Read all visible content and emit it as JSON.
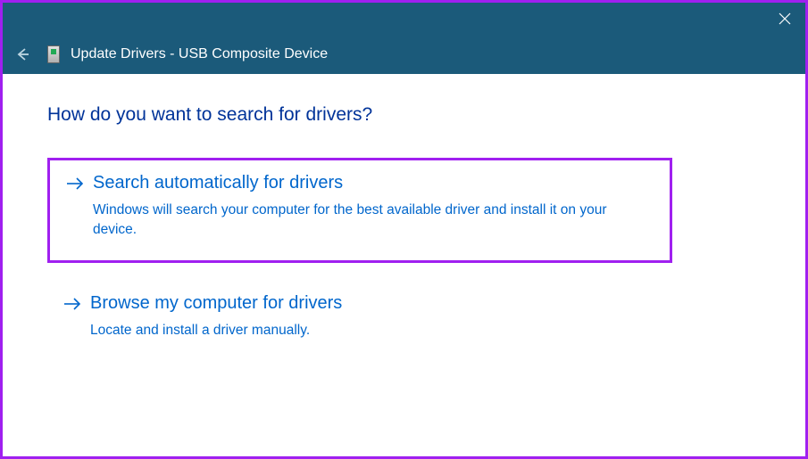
{
  "titlebar": {
    "close_label": "Close"
  },
  "header": {
    "back_label": "Back",
    "title": "Update Drivers - USB Composite Device"
  },
  "main": {
    "question": "How do you want to search for drivers?",
    "options": [
      {
        "title": "Search automatically for drivers",
        "description": "Windows will search your computer for the best available driver and install it on your device.",
        "highlighted": true
      },
      {
        "title": "Browse my computer for drivers",
        "description": "Locate and install a driver manually.",
        "highlighted": false
      }
    ]
  }
}
